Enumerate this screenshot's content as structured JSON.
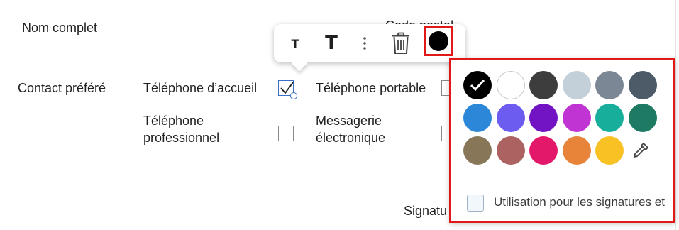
{
  "form": {
    "full_name_label": "Nom complet",
    "postal_code_label": "Code postal",
    "preferred_contact_label": "Contact préféré",
    "options": [
      {
        "label_lines": [
          "Téléphone d’accueil"
        ],
        "checked": true
      },
      {
        "label_lines": [
          "Téléphone portable"
        ],
        "checked": false
      },
      {
        "label_lines": [
          "Téléphone",
          "professionnel"
        ],
        "checked": false
      },
      {
        "label_lines": [
          "Messagerie",
          "électronique"
        ],
        "checked": false
      }
    ],
    "signature_label": "Signatu"
  },
  "toolbar": {
    "small_text_glyph": "T",
    "large_text_glyph": "T",
    "more_icon": "vertical-dots-icon",
    "delete_icon": "trash-icon",
    "current_color": "#000000"
  },
  "color_picker": {
    "swatches": [
      "#000000",
      "#ffffff",
      "#3d3d3d",
      "#c3cfd9",
      "#7b8794",
      "#4d5b69",
      "#2d87d8",
      "#6c5cf0",
      "#7314c4",
      "#c034d3",
      "#17ae9b",
      "#1f7a63",
      "#877758",
      "#ad6262",
      "#e3186a",
      "#e8843a",
      "#f8c124"
    ],
    "selected_index": 0,
    "eyedropper_icon": "eyedropper-icon",
    "use_for_signatures_label": "Utilisation pour les signatures et",
    "use_for_signatures_checked": false
  }
}
